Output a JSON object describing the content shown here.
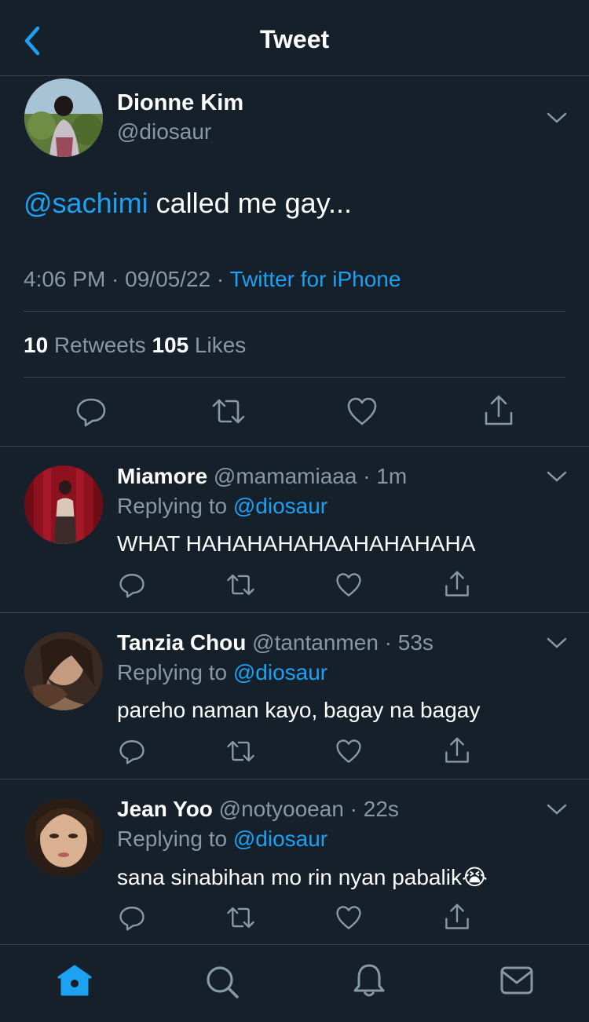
{
  "header": {
    "title": "Tweet"
  },
  "main_tweet": {
    "name": "Dionne Kim",
    "handle": "@diosaur",
    "mention": "@sachimi",
    "text": " called me gay...",
    "time": "4:06 PM · 09/05/22 · ",
    "source": "Twitter for iPhone",
    "retweets": "10",
    "retweets_label": " Retweets ",
    "likes": "105",
    "likes_label": " Likes"
  },
  "replies": [
    {
      "name": "Miamore",
      "handle": " @mamamiaaa",
      "age": " · 1m",
      "replying_label": "Replying to ",
      "replying_to": "@diosaur",
      "text": "WHAT HAHAHAHAHAAHAHAHAHA"
    },
    {
      "name": "Tanzia Chou",
      "handle": " @tantanmen",
      "age": " · 53s",
      "replying_label": "Replying to ",
      "replying_to": "@diosaur",
      "text": "pareho naman kayo, bagay na bagay"
    },
    {
      "name": "Jean Yoo",
      "handle": " @notyooean",
      "age": " · 22s",
      "replying_label": "Replying to ",
      "replying_to": "@diosaur",
      "text": "sana sinabihan mo rin nyan pabalik",
      "emoji": "😭"
    }
  ],
  "colors": {
    "background": "#15202b",
    "accent": "#1da1f2",
    "muted": "#8899a6",
    "divider": "#38444d"
  },
  "icons": {
    "back": "chevron-left-icon",
    "more": "chevron-down-icon",
    "actions": [
      "reply-icon",
      "retweet-icon",
      "like-icon",
      "share-icon"
    ],
    "tabs": [
      "home-icon",
      "search-icon",
      "notifications-icon",
      "messages-icon"
    ]
  }
}
